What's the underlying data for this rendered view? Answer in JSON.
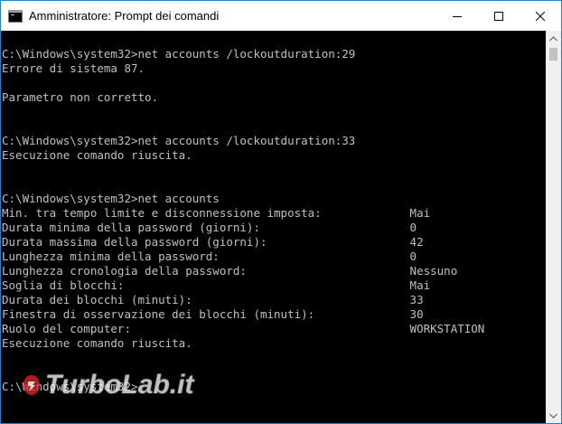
{
  "window": {
    "title": "Amministratore: Prompt dei comandi"
  },
  "console": {
    "lines": [
      "C:\\Windows\\system32>net accounts /lockoutduration:29",
      "Errore di sistema 87.",
      "",
      "Parametro non corretto.",
      "",
      "",
      "C:\\Windows\\system32>net accounts /lockoutduration:33",
      "Esecuzione comando riuscita.",
      "",
      "",
      "C:\\Windows\\system32>net accounts",
      "Min. tra tempo limite e disconnessione imposta:             Mai",
      "Durata minima della password (giorni):                      0",
      "Durata massima della password (giorni):                     42",
      "Lunghezza minima della password:                            0",
      "Lunghezza cronologia della password:                        Nessuno",
      "Soglia di blocchi:                                          Mai",
      "Durata dei blocchi (minuti):                                33",
      "Finestra di osservazione dei blocchi (minuti):              30",
      "Ruolo del computer:                                         WORKSTATION",
      "Esecuzione comando riuscita.",
      "",
      "",
      "C:\\Windows\\system32>"
    ]
  },
  "watermark": {
    "text": "TurboLab.it"
  },
  "colors": {
    "console_bg": "#000000",
    "console_fg": "#c0c0c0",
    "titlebar_bg": "#ffffff",
    "border": "#1883d7"
  },
  "icons": {
    "app": "cmd-icon",
    "minimize": "minimize-icon",
    "maximize": "maximize-icon",
    "close": "close-icon"
  }
}
